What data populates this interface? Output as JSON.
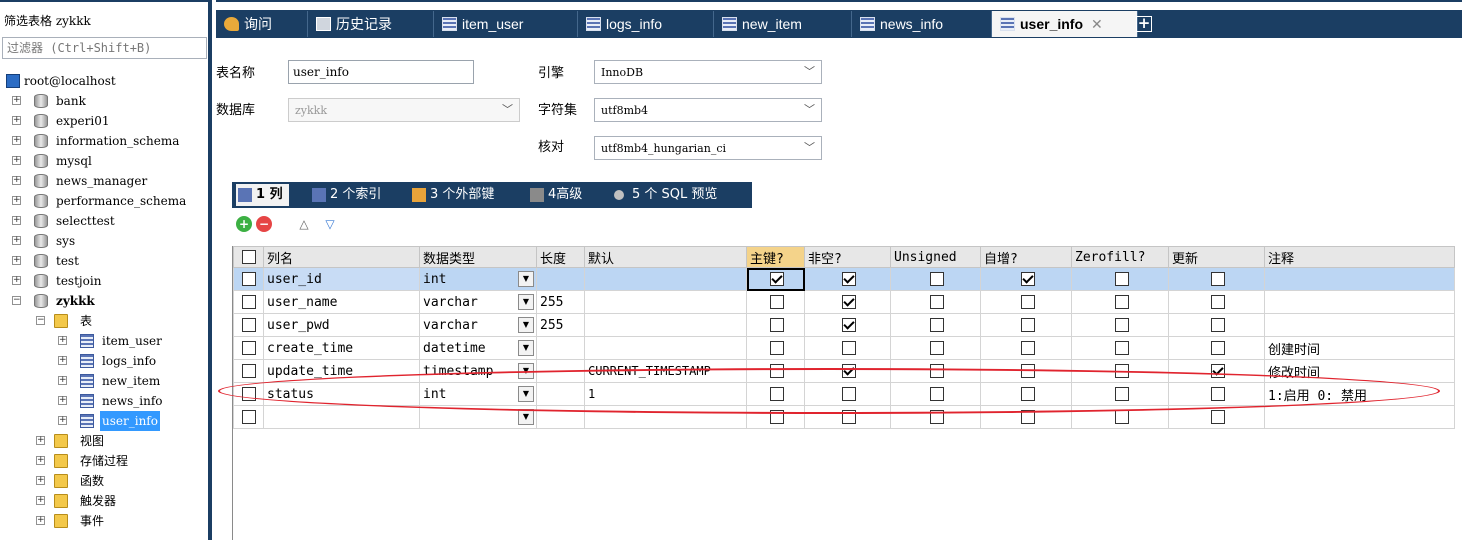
{
  "sidebar": {
    "filter_title": "筛选表格 zykkk",
    "filter_placeholder": "过滤器 (Ctrl+Shift+B)",
    "host": "root@localhost",
    "databases": [
      "bank",
      "experi01",
      "information_schema",
      "mysql",
      "news_manager",
      "performance_schema",
      "selecttest",
      "sys",
      "test",
      "testjoin"
    ],
    "active_db": "zykkk",
    "tables_folder": "表",
    "tables": [
      "item_user",
      "logs_info",
      "new_item",
      "news_info",
      "user_info"
    ],
    "selected_table": "user_info",
    "other_folders": [
      "视图",
      "存储过程",
      "函数",
      "触发器",
      "事件"
    ]
  },
  "tabs": [
    {
      "label": "询问",
      "icon": "query-icon"
    },
    {
      "label": "历史记录",
      "icon": "history-icon"
    },
    {
      "label": "item_user",
      "icon": "table-icon"
    },
    {
      "label": "logs_info",
      "icon": "table-icon"
    },
    {
      "label": "new_item",
      "icon": "table-icon"
    },
    {
      "label": "news_info",
      "icon": "table-icon"
    },
    {
      "label": "user_info",
      "icon": "table-icon",
      "active": true
    }
  ],
  "tab_close": "✕",
  "tab_add": "+",
  "form": {
    "table_name_label": "表名称",
    "table_name": "user_info",
    "database_label": "数据库",
    "database": "zykkk",
    "engine_label": "引擎",
    "engine": "InnoDB",
    "charset_label": "字符集",
    "charset": "utf8mb4",
    "collation_label": "核对",
    "collation": "utf8mb4_hungarian_ci"
  },
  "subtabs": [
    {
      "label": "1 列",
      "active": true
    },
    {
      "label": "2 个索引"
    },
    {
      "label": "3 个外部键"
    },
    {
      "label": "4高级"
    },
    {
      "label": "5 个 SQL 预览"
    }
  ],
  "grid": {
    "headers": [
      "列名",
      "数据类型",
      "长度",
      "默认",
      "主键?",
      "非空?",
      "Unsigned",
      "自增?",
      "Zerofill?",
      "更新",
      "注释"
    ],
    "rows": [
      {
        "name": "user_id",
        "type": "int",
        "length": "",
        "default": "",
        "pk": true,
        "nn": true,
        "unsigned": false,
        "ai": true,
        "zf": false,
        "upd": false,
        "comment": ""
      },
      {
        "name": "user_name",
        "type": "varchar",
        "length": "255",
        "default": "",
        "pk": false,
        "nn": true,
        "unsigned": false,
        "ai": false,
        "zf": false,
        "upd": false,
        "comment": ""
      },
      {
        "name": "user_pwd",
        "type": "varchar",
        "length": "255",
        "default": "",
        "pk": false,
        "nn": true,
        "unsigned": false,
        "ai": false,
        "zf": false,
        "upd": false,
        "comment": ""
      },
      {
        "name": "create_time",
        "type": "datetime",
        "length": "",
        "default": "",
        "pk": false,
        "nn": false,
        "unsigned": false,
        "ai": false,
        "zf": false,
        "upd": false,
        "comment": "创建时间"
      },
      {
        "name": "update_time",
        "type": "timestamp",
        "length": "",
        "default": "CURRENT_TIMESTAMP",
        "pk": false,
        "nn": true,
        "unsigned": false,
        "ai": false,
        "zf": false,
        "upd": true,
        "comment": "修改时间"
      },
      {
        "name": "status",
        "type": "int",
        "length": "",
        "default": "1",
        "pk": false,
        "nn": false,
        "unsigned": false,
        "ai": false,
        "zf": false,
        "upd": false,
        "comment": "1:启用 0: 禁用"
      },
      {
        "name": "",
        "type": "",
        "length": "",
        "default": "",
        "pk": false,
        "nn": false,
        "unsigned": false,
        "ai": false,
        "zf": false,
        "upd": false,
        "comment": ""
      }
    ]
  },
  "colors": {
    "dark_blue": "#1b3e63",
    "highlight": "#bcd6f3",
    "pk_header": "#f4d38a",
    "annotation_red": "#e0242e"
  }
}
